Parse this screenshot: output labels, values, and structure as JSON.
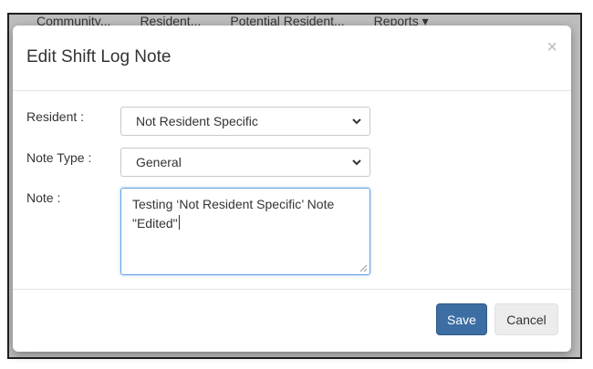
{
  "nav": {
    "items": [
      "Community...",
      "Resident...",
      "Potential Resident...",
      "Reports"
    ]
  },
  "modal": {
    "title": "Edit Shift Log Note",
    "close_glyph": "×",
    "fields": {
      "resident": {
        "label": "Resident :",
        "value": "Not Resident Specific"
      },
      "note_type": {
        "label": "Note Type :",
        "value": "General"
      },
      "note": {
        "label": "Note :",
        "value": "Testing ‘Not Resident Specific’ Note\n\"Edited\""
      }
    },
    "buttons": {
      "save": "Save",
      "cancel": "Cancel"
    }
  },
  "colors": {
    "primary": "#3d6ea3",
    "focus_border": "#66a3e0",
    "backdrop": "#bdbdbd"
  }
}
